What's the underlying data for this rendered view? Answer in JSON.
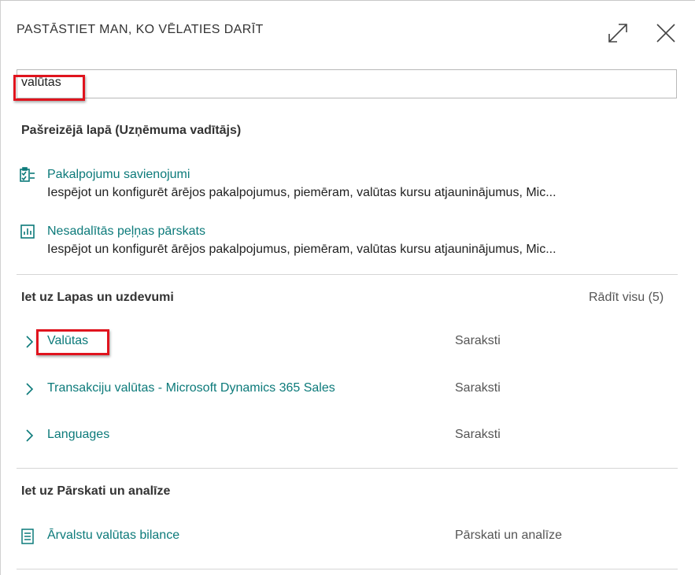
{
  "dialog": {
    "title": "PASTĀSTIET MAN, KO VĒLATIES DARĪT"
  },
  "search": {
    "value": "valūtas"
  },
  "current_page": {
    "heading": "Pašreizējā lapā (Uzņēmuma vadītājs)",
    "items": [
      {
        "title": "Pakalpojumu savienojumi",
        "description": "Iespējot un konfigurēt ārējos pakalpojumus, piemēram, valūtas kursu atjauninājumus, Mic...",
        "icon": "checklist-icon"
      },
      {
        "title": "Nesadalītās peļņas pārskats",
        "description": "Iespējot un konfigurēt ārējos pakalpojumus, piemēram, valūtas kursu atjauninājumus, Mic...",
        "icon": "report-chart-icon"
      }
    ]
  },
  "pages_tasks": {
    "heading": "Iet uz Lapas un uzdevumi",
    "show_all": "Rādīt visu (5)",
    "items": [
      {
        "title": "Valūtas",
        "type": "Saraksti",
        "icon": "chevron-right-icon"
      },
      {
        "title": "Transakciju valūtas - Microsoft Dynamics 365 Sales",
        "type": "Saraksti",
        "icon": "chevron-right-icon"
      },
      {
        "title": "Languages",
        "type": "Saraksti",
        "icon": "chevron-right-icon"
      }
    ]
  },
  "reports": {
    "heading": "Iet uz Pārskati un analīze",
    "items": [
      {
        "title": "Ārvalstu valūtas bilance",
        "type": "Pārskati un analīze",
        "icon": "document-report-icon"
      }
    ]
  },
  "colors": {
    "link": "#0c7a7a",
    "highlight": "#e0141e"
  }
}
